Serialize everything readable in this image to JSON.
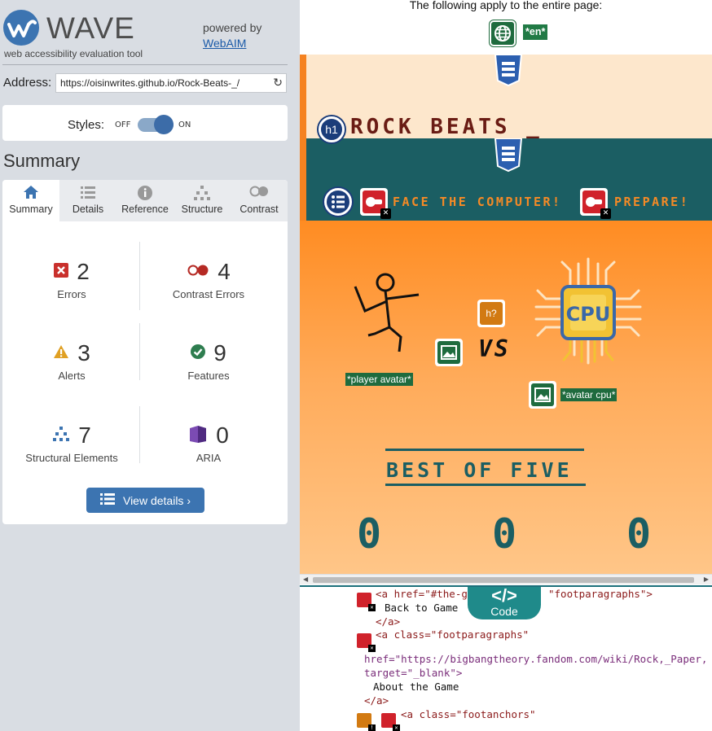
{
  "wave": {
    "logo_text": "WAVE",
    "tagline": "web accessibility evaluation tool",
    "powered_by": "powered by",
    "webaim_link": "WebAIM"
  },
  "address": {
    "label": "Address:",
    "value": "https://oisinwrites.github.io/Rock-Beats-_/"
  },
  "styles": {
    "label": "Styles:",
    "off": "OFF",
    "on": "ON",
    "state": "on"
  },
  "summary": {
    "heading": "Summary",
    "tabs": [
      {
        "label": "Summary",
        "icon": "home-icon"
      },
      {
        "label": "Details",
        "icon": "list-icon"
      },
      {
        "label": "Reference",
        "icon": "info-icon"
      },
      {
        "label": "Structure",
        "icon": "structure-icon"
      },
      {
        "label": "Contrast",
        "icon": "contrast-icon"
      }
    ],
    "stats": [
      {
        "count": "2",
        "label": "Errors",
        "icon": "error-icon",
        "color": "#d0222b"
      },
      {
        "count": "4",
        "label": "Contrast Errors",
        "icon": "contrast-error-icon",
        "color": "#d0222b"
      },
      {
        "count": "3",
        "label": "Alerts",
        "icon": "alert-icon",
        "color": "#d4a017"
      },
      {
        "count": "9",
        "label": "Features",
        "icon": "feature-check-icon",
        "color": "#2e7d4f"
      },
      {
        "count": "7",
        "label": "Structural Elements",
        "icon": "structure-icon",
        "color": "#3c74b1"
      },
      {
        "count": "0",
        "label": "ARIA",
        "icon": "aria-icon",
        "color": "#5b2d8e"
      }
    ],
    "view_details": "View details ›"
  },
  "page_preview": {
    "apply_text": "The following apply to the entire page:",
    "lang_tag": "*en*",
    "h1_badge": "h1",
    "title": "ROCK BEATS _",
    "nav_left": "FACE THE COMPUTER!",
    "nav_right": "PREPARE!",
    "alert_badge": "h?",
    "player_alt": "*player avatar*",
    "cpu_alt": "*avatar cpu*",
    "cpu_label": "CPU",
    "vs": "VS",
    "best_of": "BEST OF FIVE",
    "scores": [
      "0",
      "0",
      "0"
    ]
  },
  "code_panel": {
    "tab_symbol": "</>",
    "tab_label": "Code",
    "lines": [
      "<a href=\"#the-g",
      "\"footparagraphs\">",
      "Back to Game",
      "</a>",
      "<a class=\"footparagraphs\"",
      "href=\"https://bigbangtheory.fandom.com/wiki/Rock,_Paper,",
      "target=\"_blank\">",
      "About the Game",
      "</a>",
      "<a class=\"footanchors\""
    ]
  }
}
